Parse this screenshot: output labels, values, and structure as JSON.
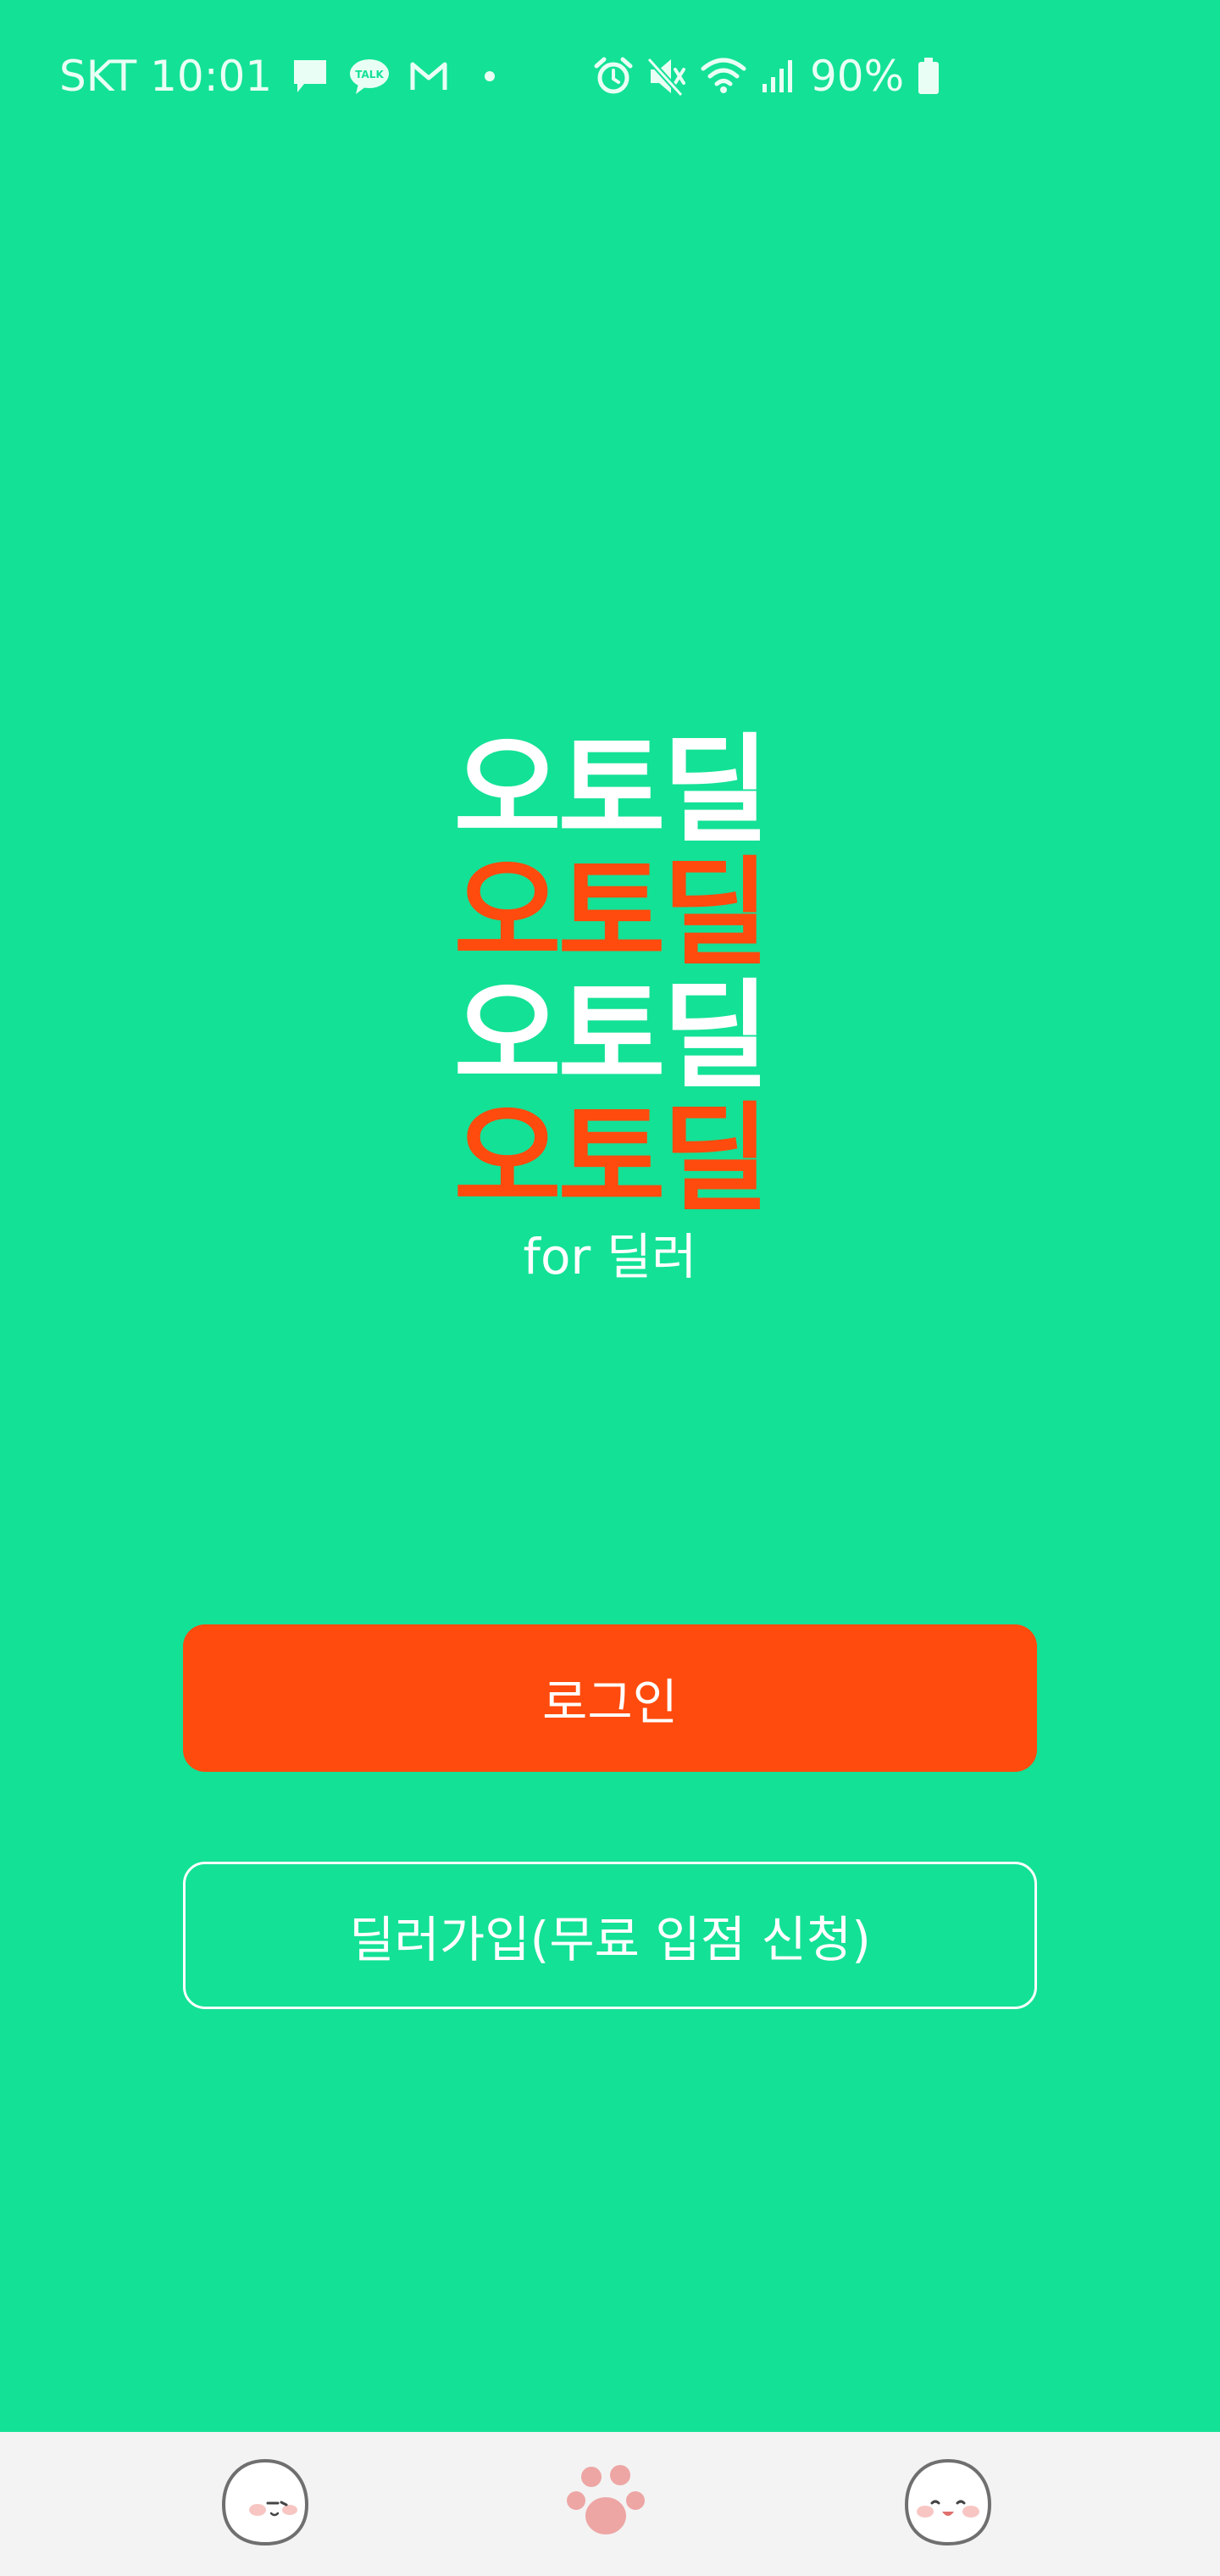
{
  "status_bar": {
    "carrier_time": "SKT 10:01",
    "battery": "90%",
    "icons_left": [
      "message-icon",
      "kakaotalk-icon",
      "gmail-icon",
      "dot-icon"
    ],
    "icons_right": [
      "alarm-icon",
      "mute-icon",
      "wifi-icon",
      "signal-icon",
      "battery-icon"
    ],
    "color": "#ffffff"
  },
  "logo": {
    "lines": [
      "오토딜",
      "오토딜",
      "오토딜",
      "오토딜"
    ],
    "subtitle": "for 딜러",
    "colors": [
      "#ffffff",
      "#ff4b0d"
    ]
  },
  "buttons": {
    "login_label": "로그인",
    "signup_label": "딜러가입(무료 입점 신청)"
  },
  "tabbar": {
    "tabs": [
      {
        "icon": "mascot-face-icon"
      },
      {
        "icon": "paw-icon"
      },
      {
        "icon": "mascot-smile-icon"
      }
    ]
  },
  "colors": {
    "background": "#13e196",
    "accent": "#ff4b0d",
    "tabbar_bg": "#f3f3f3"
  }
}
